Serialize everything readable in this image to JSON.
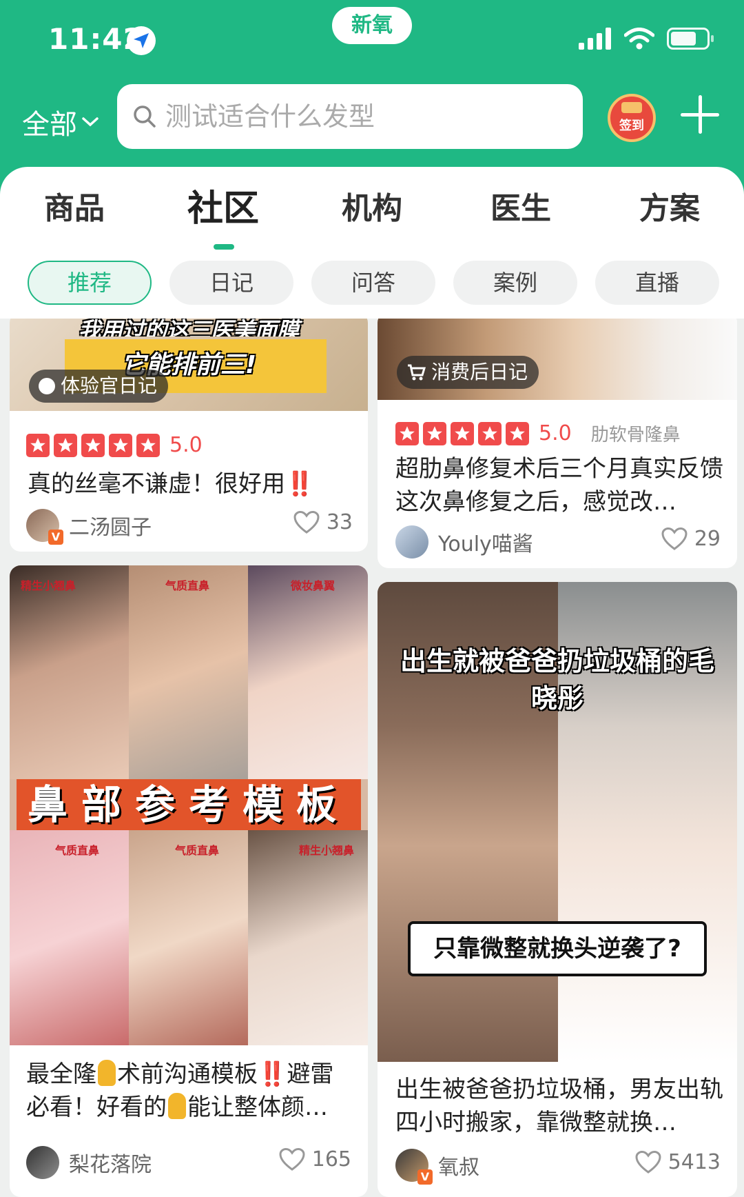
{
  "status_bar": {
    "time": "11:42",
    "island_label": "新氧"
  },
  "header": {
    "scope_label": "全部",
    "search_placeholder": "测试适合什么发型",
    "checkin_label": "签到"
  },
  "tabs": [
    {
      "label": "商品",
      "active": false
    },
    {
      "label": "社区",
      "active": true
    },
    {
      "label": "机构",
      "active": false
    },
    {
      "label": "医生",
      "active": false
    },
    {
      "label": "方案",
      "active": false
    }
  ],
  "chips": [
    {
      "label": "推荐",
      "active": true
    },
    {
      "label": "日记",
      "active": false
    },
    {
      "label": "问答",
      "active": false
    },
    {
      "label": "案例",
      "active": false
    },
    {
      "label": "直播",
      "active": false
    }
  ],
  "cards": [
    {
      "image_text": "我用过的这三医美面膜",
      "image_text_2": "它能排前三!",
      "badge": "体验官日记",
      "rating": "5.0",
      "title": "真的丝毫不谦虚！很好用",
      "title_mark": "‼️",
      "author": "二汤圆子",
      "likes": "33"
    },
    {
      "badge": "消费后日记",
      "rating": "5.0",
      "tag": "肋软骨隆鼻",
      "title": "超肋鼻修复术后三个月真实反馈这次鼻修复之后，感觉改…",
      "author": "Youly喵酱",
      "likes": "29"
    },
    {
      "image_banner": "鼻部参考模板",
      "image_labels": [
        "精生小翘鼻",
        "气质直鼻",
        "微妆鼻翼",
        "气质直鼻",
        "气质直鼻",
        "精生小翘鼻"
      ],
      "title_part1": "最全隆",
      "title_part2": "术前沟通模板",
      "title_mark": "‼️",
      "title_part3": "避雷必看！好看的",
      "title_part4": "能让整体颜…",
      "author": "梨花落院",
      "likes": "165"
    },
    {
      "image_headline": "出生就被爸爸扔垃圾桶的毛晓彤",
      "image_bubble": "只靠微整就换头逆袭了?",
      "title": "出生被爸爸扔垃圾桶，男友出轨四小时搬家，靠微整就换…",
      "author": "氧叔",
      "likes": "5413"
    }
  ],
  "colors": {
    "brand": "#1fb884",
    "rating": "#f04b4b",
    "warning": "#e8363a"
  }
}
